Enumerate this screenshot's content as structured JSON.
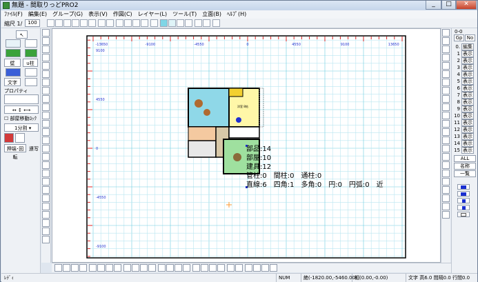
{
  "window": {
    "title": "無題 - 間取りっどPRO2"
  },
  "menu": [
    "ﾌｧｲﾙ(F)",
    "編集(E)",
    "グループ(G)",
    "表示(V)",
    "作図(C)",
    "レイヤー(L)",
    "ツール(T)",
    "立面(B)",
    "ﾍﾙﾌﾟ(H)"
  ],
  "toolbar": {
    "scale_label": "縮尺 1/",
    "scale_value": "100"
  },
  "left_panel": {
    "wall_label": "壁",
    "pillar_label": "u柱",
    "text_label": "文字",
    "property_label": "プロパティ",
    "room_move_lock_label": "部屋移動ﾛｯｸ",
    "split_select_value": "1分割",
    "mirror_rotate_label": "押端･回転",
    "continuous_label": "連写"
  },
  "ruler": {
    "top_ticks": [
      "-13650",
      "-9100",
      "-4550",
      "0",
      "4550",
      "9100",
      "13650"
    ],
    "side_ticks": [
      "9100",
      "4550",
      "0",
      "-4550",
      "-9100"
    ]
  },
  "floorplan": {
    "room_label": "洋室\n8帖"
  },
  "info": {
    "parts": "部品:14",
    "rooms": "部屋:10",
    "fixtures": "建具:12",
    "pillars": "管柱:0　間柱:0　通柱:0",
    "lines": "直線:6　四角:1　多角:0　円:0　円弧:0　近"
  },
  "right_panel": {
    "header": "0-0",
    "tab_gp": "Gp",
    "tab_no": "No",
    "rows": [
      {
        "n": "0.",
        "label": "編集"
      },
      {
        "n": "1",
        "label": "表示"
      },
      {
        "n": "2",
        "label": "表示"
      },
      {
        "n": "3",
        "label": "表示"
      },
      {
        "n": "4",
        "label": "表示"
      },
      {
        "n": "5",
        "label": "表示"
      },
      {
        "n": "6",
        "label": "表示"
      },
      {
        "n": "7",
        "label": "表示"
      },
      {
        "n": "8",
        "label": "表示"
      },
      {
        "n": "9",
        "label": "表示"
      },
      {
        "n": "10",
        "label": "表示"
      },
      {
        "n": "11",
        "label": "表示"
      },
      {
        "n": "12",
        "label": "表示"
      },
      {
        "n": "13",
        "label": "表示"
      },
      {
        "n": "14",
        "label": "表示"
      },
      {
        "n": "15",
        "label": "表示"
      }
    ],
    "all_label": "ALL",
    "name_label": "名称",
    "list_label": "一覧"
  },
  "status": {
    "ready": "ﾚﾃﾞｨ",
    "num": "NUM",
    "abs_coord": "絶(-1820.00,-5460.00)",
    "rel_coord": "相(0.00,-0.00)",
    "text_info": "文字 高6.0 間隔0.0 行間0.0"
  },
  "colors": {
    "grid": "#b9e6f0",
    "grid_major": "#6ccde0",
    "ruler_red": "#e02020",
    "ruler_blue": "#2030d0"
  }
}
